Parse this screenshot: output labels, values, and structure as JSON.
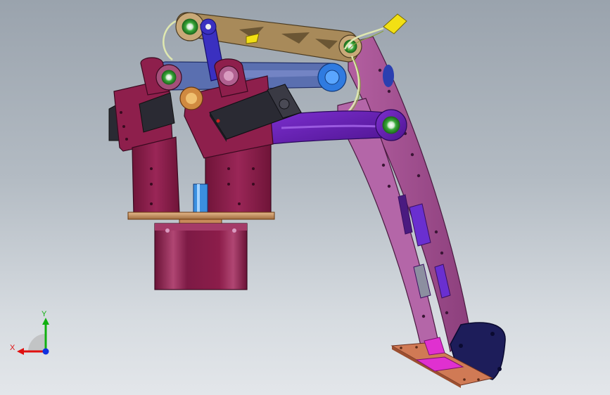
{
  "viewport": {
    "background_top": "#9aa3ad",
    "background_bottom": "#e3e6ea"
  },
  "model": {
    "name_visible": "",
    "servo_labels": [
      "",
      ""
    ],
    "colors": {
      "base_tower": "#8e1f4c",
      "base_plate": "#c99a6a",
      "motor_block": "#8c1d4a",
      "upper_link": "#a88a5a",
      "mid_link": "#4a5fa8",
      "side_arm": "#8a3a9a",
      "long_arm": "#a2508f",
      "purple_link": "#6a1fb0",
      "servo_body": "#2a2a33",
      "bearing": "#3aaa3a",
      "blue_joint": "#2f7be0",
      "end_plate": "#d07a55",
      "gripper_plate": "#e030d0",
      "wire": "#dfe8b0",
      "connector": "#f2e014"
    }
  },
  "triad": {
    "x_label": "X",
    "y_label": "Y",
    "x_color": "#e01010",
    "y_color": "#10b010",
    "z_color": "#1030e0",
    "icon": "coordinate-triad-icon"
  }
}
